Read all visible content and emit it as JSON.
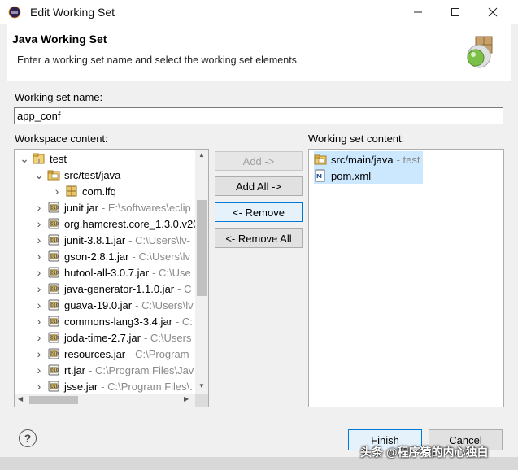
{
  "window": {
    "title": "Edit Working Set"
  },
  "banner": {
    "title": "Java Working Set",
    "description": "Enter a working set name and select the working set elements."
  },
  "form": {
    "name_label": "Working set name:",
    "name_value": "app_conf",
    "workspace_label": "Workspace content:",
    "working_set_label": "Working set content:"
  },
  "tree": [
    {
      "label": "test",
      "path": "",
      "icon": "project-icon",
      "expanded": true
    },
    {
      "label": "src/test/java",
      "path": "",
      "icon": "source-folder-icon",
      "expanded": true
    },
    {
      "label": "com.lfq",
      "path": "",
      "icon": "package-icon",
      "expanded": false
    },
    {
      "label": "junit.jar",
      "path": "- E:\\softwares\\eclip",
      "icon": "jar-icon",
      "expanded": false
    },
    {
      "label": "org.hamcrest.core_1.3.0.v20",
      "path": "",
      "icon": "jar-icon",
      "expanded": false
    },
    {
      "label": "junit-3.8.1.jar",
      "path": "- C:\\Users\\lv-",
      "icon": "jar-icon",
      "expanded": false
    },
    {
      "label": "gson-2.8.1.jar",
      "path": "- C:\\Users\\lv",
      "icon": "jar-icon",
      "expanded": false
    },
    {
      "label": "hutool-all-3.0.7.jar",
      "path": "- C:\\Use",
      "icon": "jar-icon",
      "expanded": false
    },
    {
      "label": "java-generator-1.1.0.jar",
      "path": "- C",
      "icon": "jar-icon",
      "expanded": false
    },
    {
      "label": "guava-19.0.jar",
      "path": "- C:\\Users\\lv",
      "icon": "jar-icon",
      "expanded": false
    },
    {
      "label": "commons-lang3-3.4.jar",
      "path": "- C:",
      "icon": "jar-icon",
      "expanded": false
    },
    {
      "label": "joda-time-2.7.jar",
      "path": "- C:\\Users",
      "icon": "jar-icon",
      "expanded": false
    },
    {
      "label": "resources.jar",
      "path": "- C:\\Program",
      "icon": "jar-icon",
      "expanded": false
    },
    {
      "label": "rt.jar",
      "path": "- C:\\Program Files\\Jav",
      "icon": "jar-icon",
      "expanded": false
    },
    {
      "label": "jsse.jar",
      "path": "- C:\\Program Files\\.",
      "icon": "jar-icon",
      "expanded": false
    }
  ],
  "buttons": {
    "add": "Add ->",
    "add_all": "Add All ->",
    "remove": "<- Remove",
    "remove_all": "<- Remove All",
    "finish": "Finish",
    "cancel": "Cancel",
    "help": "?"
  },
  "working_set": [
    {
      "label": "src/main/java",
      "path": "- test",
      "icon": "source-folder-icon"
    },
    {
      "label": "pom.xml",
      "path": "",
      "icon": "xml-file-icon"
    }
  ],
  "watermark": "头条 @程序猿的内心独白",
  "colors": {
    "accent": "#0078d7",
    "selection": "#cce8ff",
    "muted_path": "#8a8a8a"
  }
}
